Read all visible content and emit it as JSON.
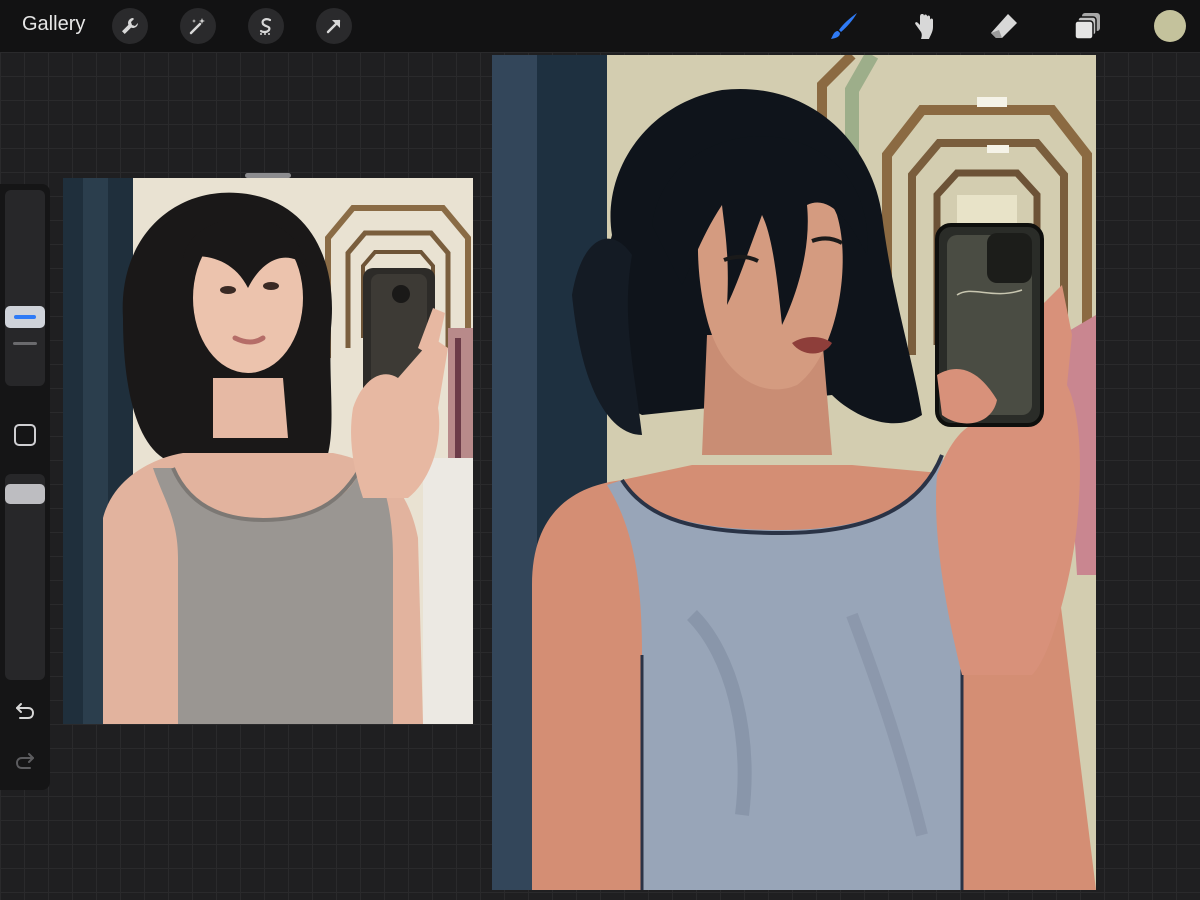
{
  "topbar": {
    "gallery_label": "Gallery",
    "left_tools": [
      "actions-wrench-icon",
      "adjustments-magic-wand-icon",
      "selection-s-icon",
      "transform-arrow-icon"
    ],
    "right_tools": [
      "brush-icon",
      "smudge-icon",
      "eraser-icon",
      "layers-icon"
    ],
    "active_tool": "brush-icon",
    "active_color": "#c4c29c",
    "accent": "#2f7bf6"
  },
  "sidebar": {
    "controls": [
      "brush-size-slider",
      "modify-button",
      "opacity-slider",
      "undo-button",
      "redo-button"
    ]
  },
  "reference": {
    "kind": "reference-photo"
  },
  "canvas": {
    "kind": "painting"
  }
}
